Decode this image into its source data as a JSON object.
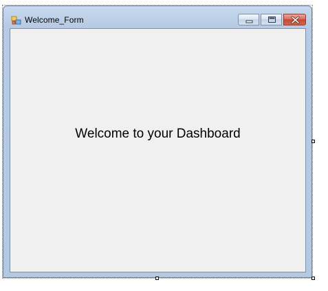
{
  "window": {
    "title": "Welcome_Form",
    "icon": "form-app-icon",
    "caption_buttons": [
      {
        "name": "minimize",
        "icon": "minimize-icon"
      },
      {
        "name": "maximize",
        "icon": "maximize-icon"
      },
      {
        "name": "close",
        "icon": "close-icon"
      }
    ]
  },
  "form": {
    "welcome_text": "Welcome to your Dashboard"
  },
  "colors": {
    "title_bar": "#b9cde4",
    "client_background": "#f0f0f0",
    "close_button": "#c9503a"
  }
}
